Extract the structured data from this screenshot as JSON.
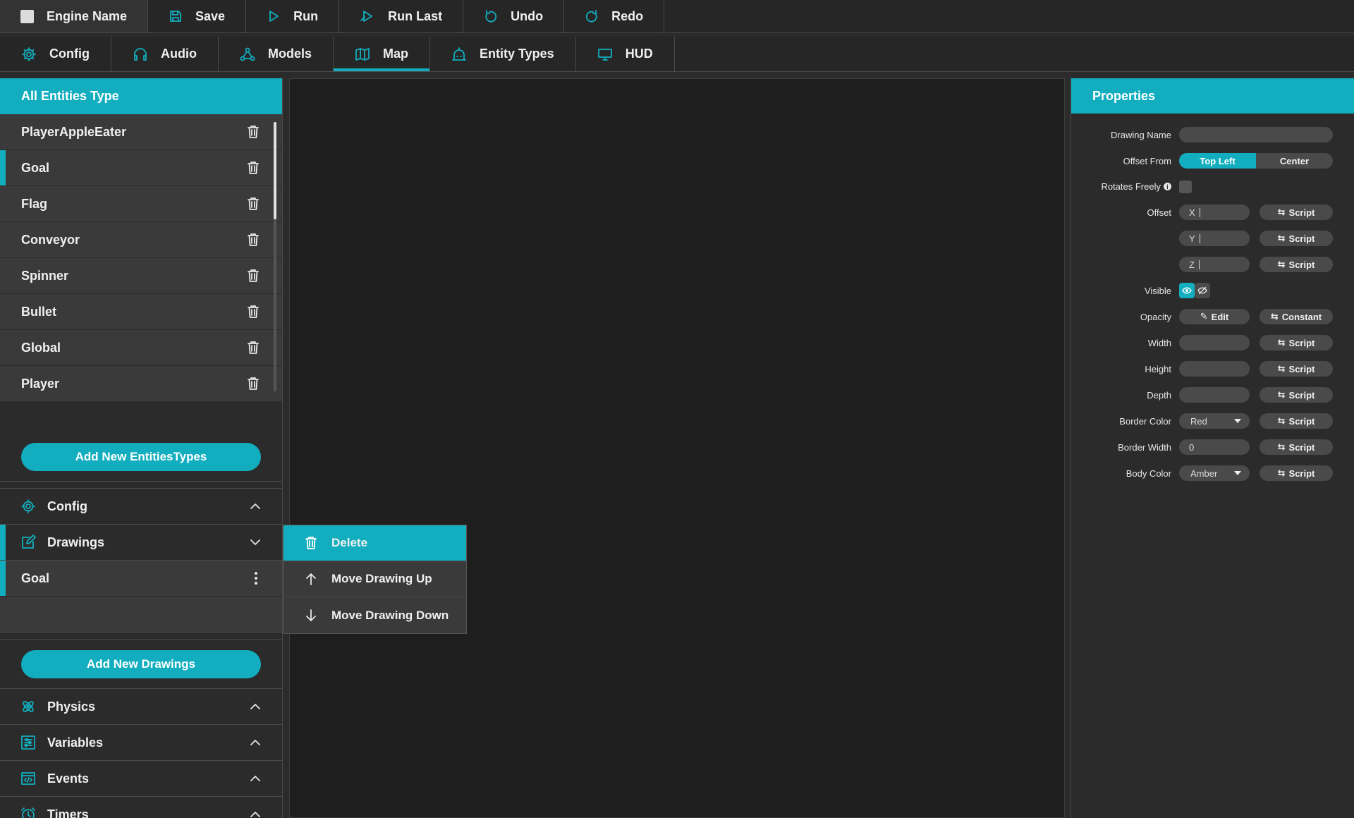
{
  "toolbar": {
    "engine_name": "Engine Name",
    "save": "Save",
    "run": "Run",
    "run_last": "Run Last",
    "undo": "Undo",
    "redo": "Redo"
  },
  "tabs": {
    "config": "Config",
    "audio": "Audio",
    "models": "Models",
    "map": "Map",
    "entity_types": "Entity Types",
    "hud": "HUD",
    "active": "Map"
  },
  "entities": {
    "header": "All Entities Type",
    "items": [
      "PlayerAppleEater",
      "Goal",
      "Flag",
      "Conveyor",
      "Spinner",
      "Bullet",
      "Global",
      "Player"
    ],
    "selected": "Goal",
    "add_button": "Add New EntitiesTypes"
  },
  "sections": {
    "config": "Config",
    "drawings": "Drawings",
    "drawing_item": "Goal",
    "add_drawings": "Add New Drawings",
    "physics": "Physics",
    "variables": "Variables",
    "events": "Events",
    "timers": "Timers"
  },
  "context_menu": {
    "delete": "Delete",
    "move_up": "Move Drawing Up",
    "move_down": "Move Drawing Down"
  },
  "properties": {
    "header": "Properties",
    "drawing_name_label": "Drawing Name",
    "drawing_name_value": "",
    "offset_from_label": "Offset From",
    "offset_from_options": [
      "Top Left",
      "Center"
    ],
    "offset_from_selected": "Top Left",
    "rotates_freely_label": "Rotates Freely",
    "rotates_freely_checked": false,
    "offset_label": "Offset",
    "offset_x": "X",
    "offset_y": "Y",
    "offset_z": "Z",
    "script": "Script",
    "visible_label": "Visible",
    "visible": true,
    "opacity_label": "Opacity",
    "edit": "Edit",
    "constant": "Constant",
    "width_label": "Width",
    "height_label": "Height",
    "depth_label": "Depth",
    "border_color_label": "Border Color",
    "border_color_value": "Red",
    "border_width_label": "Border Width",
    "border_width_value": "0",
    "body_color_label": "Body Color",
    "body_color_value": "Amber"
  },
  "colors": {
    "accent": "#12aebf",
    "background": "#2b2b2b",
    "canvas": "#1e1e1e",
    "row": "#3a3a3a"
  }
}
